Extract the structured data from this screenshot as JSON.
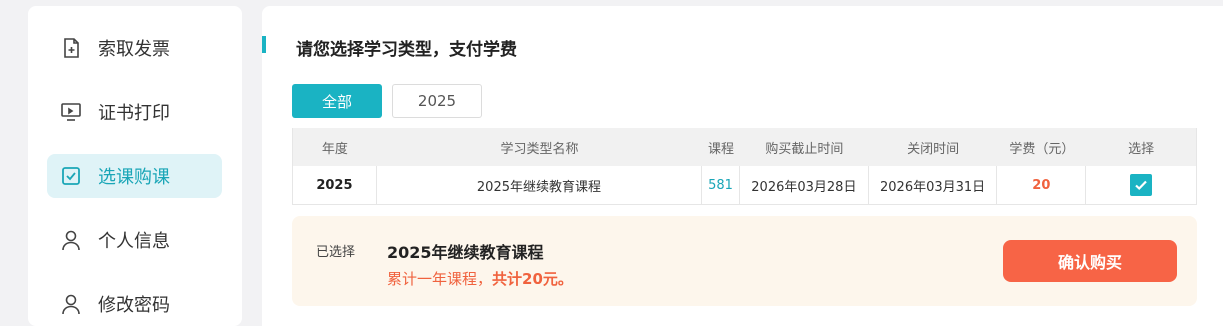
{
  "sidebar": {
    "items": [
      {
        "label": "索取发票",
        "icon": "invoice-add-icon",
        "active": false
      },
      {
        "label": "证书打印",
        "icon": "monitor-print-icon",
        "active": false
      },
      {
        "label": "选课购课",
        "icon": "checkbox-select-icon",
        "active": true
      },
      {
        "label": "个人信息",
        "icon": "user-icon",
        "active": false
      },
      {
        "label": "修改密码",
        "icon": "lock-user-icon",
        "active": false
      }
    ]
  },
  "main": {
    "title": "请您选择学习类型，支付学费",
    "tabs": [
      {
        "label": "全部",
        "active": true
      },
      {
        "label": "2025",
        "active": false
      }
    ],
    "table": {
      "headers": [
        "年度",
        "学习类型名称",
        "课程",
        "购买截止时间",
        "关闭时间",
        "学费（元）",
        "选择"
      ],
      "rows": [
        {
          "year": "2025",
          "name": "2025年继续教育课程",
          "courses": "581",
          "deadline": "2026年03月28日",
          "close": "2026年03月31日",
          "fee": "20",
          "selected": true
        }
      ]
    },
    "summary": {
      "selected_label": "已选择",
      "selected_title": "2025年继续教育课程",
      "desc_prefix": "累计一年课程，",
      "desc_total": "共计20元。",
      "confirm_label": "确认购买"
    }
  },
  "colors": {
    "accent": "#1ab3c3",
    "price": "#f0623e",
    "confirm": "#f76446",
    "summary_bg": "#fdf6ec"
  }
}
